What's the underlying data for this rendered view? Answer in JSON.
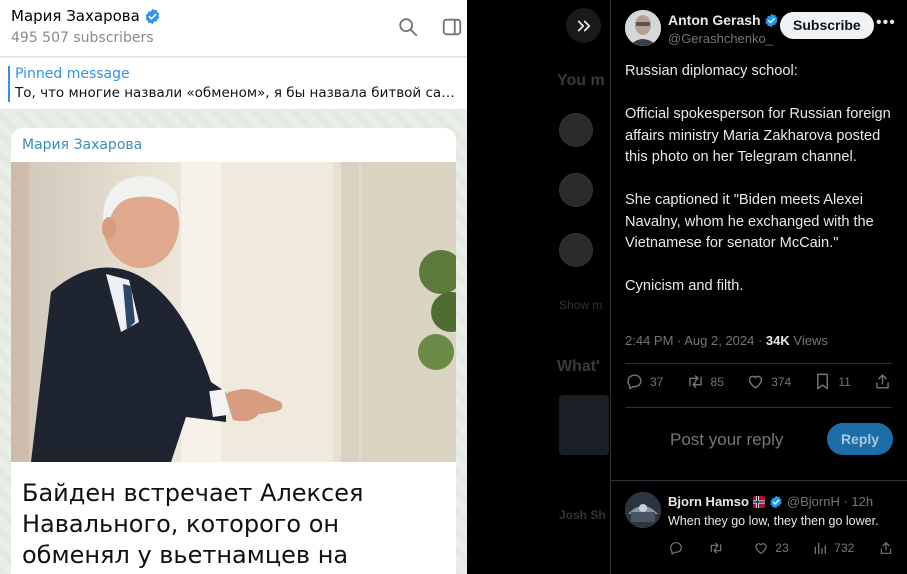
{
  "telegram": {
    "channel_name": "Мария Захарова",
    "subscribers": "495 507 subscribers",
    "pinned_title": "Pinned message",
    "pinned_text": "То, что многие назвали «обменом», я бы назвала битвой сам...",
    "message_author": "Мария Захарова",
    "caption": "Байден встречает Алексея Навального, которого он обменял у вьетнамцев на сенатора Маккейна",
    "accent_color": "#3390ec"
  },
  "tweet": {
    "author_name": "Anton Gerash",
    "author_handle": "@Gerashchenko_e",
    "subscribe_label": "Subscribe",
    "body": "Russian diplomacy school:\n\nOfficial spokesperson for Russian foreign affairs ministry Maria Zakharova posted this photo on her Telegram channel.\n\nShe captioned it \"Biden meets Alexei Navalny, whom he exchanged with the Vietnamese for senator McCain.\"\n\nCynicism and filth.",
    "timestamp": "2:44 PM · Aug 2, 2024 · ",
    "views_count": "34K",
    "views_label": " Views",
    "replies": "37",
    "reposts": "85",
    "likes": "374",
    "bookmarks": "11",
    "reply_placeholder": "Post your reply",
    "reply_button": "Reply"
  },
  "reply": {
    "author_name": "Bjorn Hamso",
    "author_handle": "@BjornH · 12h",
    "text": "When they go low, they then go lower.",
    "reposts": "",
    "likes": "23",
    "views": "732"
  }
}
